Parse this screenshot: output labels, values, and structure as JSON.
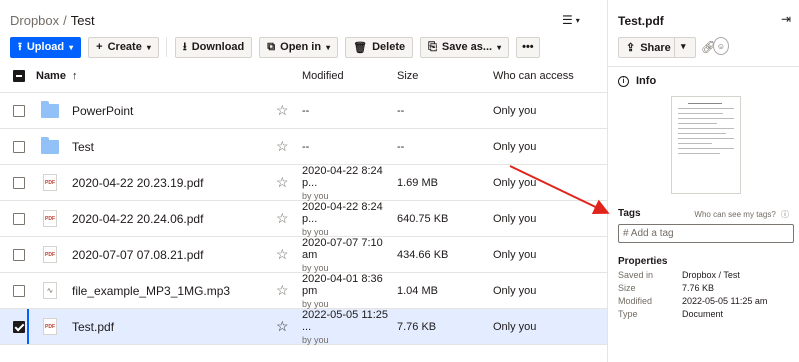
{
  "breadcrumb": {
    "parent": "Dropbox",
    "separator": "/",
    "current": "Test"
  },
  "view_toggle": {
    "icon": "list-view-icon"
  },
  "toolbar": {
    "upload": "Upload",
    "create": "Create",
    "download": "Download",
    "open_in": "Open in",
    "delete": "Delete",
    "save_as": "Save as...",
    "more": "•••"
  },
  "table": {
    "headers": {
      "name": "Name",
      "modified": "Modified",
      "size": "Size",
      "access": "Who can access"
    },
    "rows": [
      {
        "name": "PowerPoint",
        "type": "folder",
        "modified": "--",
        "modified_by": "",
        "size": "--",
        "access": "Only you",
        "selected": false
      },
      {
        "name": "Test",
        "type": "folder",
        "modified": "--",
        "modified_by": "",
        "size": "--",
        "access": "Only you",
        "selected": false
      },
      {
        "name": "2020-04-22 20.23.19.pdf",
        "type": "pdf",
        "modified": "2020-04-22 8:24 p...",
        "modified_by": "by you",
        "size": "1.69 MB",
        "access": "Only you",
        "selected": false
      },
      {
        "name": "2020-04-22 20.24.06.pdf",
        "type": "pdf",
        "modified": "2020-04-22 8:24 p...",
        "modified_by": "by you",
        "size": "640.75 KB",
        "access": "Only you",
        "selected": false
      },
      {
        "name": "2020-07-07 07.08.21.pdf",
        "type": "pdf",
        "modified": "2020-07-07 7:10 am",
        "modified_by": "by you",
        "size": "434.66 KB",
        "access": "Only you",
        "selected": false
      },
      {
        "name": "file_example_MP3_1MG.mp3",
        "type": "mp3",
        "modified": "2020-04-01 8:36 pm",
        "modified_by": "by you",
        "size": "1.04 MB",
        "access": "Only you",
        "selected": false
      },
      {
        "name": "Test.pdf",
        "type": "pdf",
        "modified": "2022-05-05 11:25 ...",
        "modified_by": "by you",
        "size": "7.76 KB",
        "access": "Only you",
        "selected": true
      }
    ]
  },
  "panel": {
    "title": "Test.pdf",
    "share": "Share",
    "info": "Info",
    "tags_label": "Tags",
    "who_can_see": "Who can see my tags?",
    "tag_placeholder": "# Add a tag",
    "properties_label": "Properties",
    "properties": [
      {
        "key": "Saved in",
        "value": "Dropbox  /  Test"
      },
      {
        "key": "Size",
        "value": "7.76 KB"
      },
      {
        "key": "Modified",
        "value": "2022-05-05 11:25 am"
      },
      {
        "key": "Type",
        "value": "Document"
      }
    ]
  },
  "colors": {
    "accent": "#0061fe",
    "arrow": "#e0241b",
    "selected_row": "#e4edff"
  }
}
